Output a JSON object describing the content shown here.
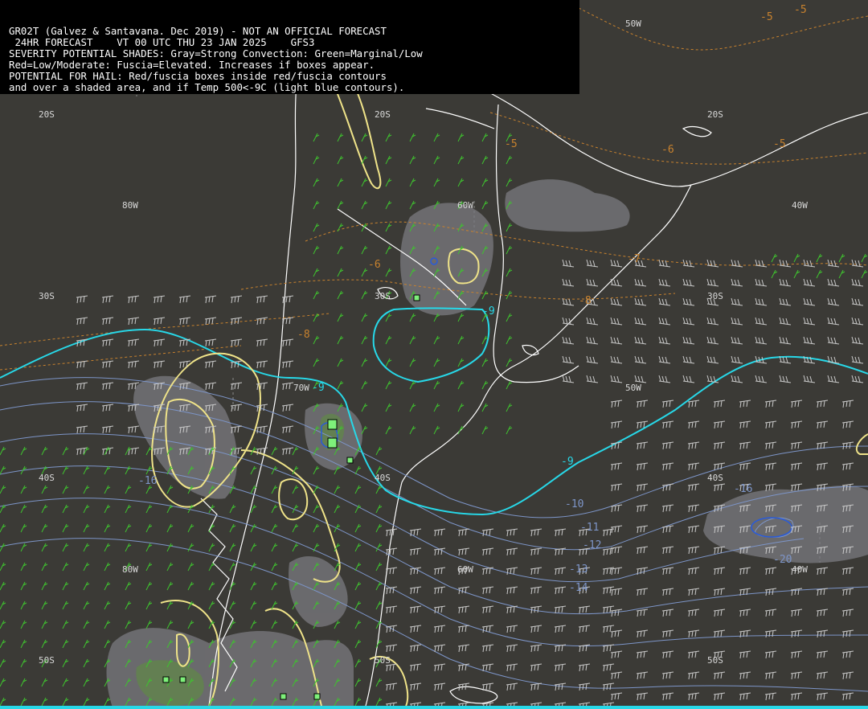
{
  "header": {
    "lines": [
      "GR02T (Galvez & Santavana. Dec 2019) - NOT AN OFFICIAL FORECAST",
      " 24HR FORECAST    VT 00 UTC THU 23 JAN 2025    GFS3",
      "SEVERITY POTENTIAL SHADES: Gray=Strong Convection: Green=Marginal/Low",
      "Red=Low/Moderate: Fuscia=Elevated. Increases if boxes appear.",
      "POTENTIAL FOR HAIL: Red/fuscia boxes inside red/fuscia contours",
      "and over a shaded area, and if Temp 500<-9C (light blue contours)."
    ]
  },
  "grid_labels": {
    "lat_20s": "20S",
    "lat_30s": "30S",
    "lat_40s": "40S",
    "lat_50s": "50S",
    "lon_80w": "80W",
    "lon_70w": "70W",
    "lon_60w": "60W",
    "lon_50w": "50W",
    "lon_40w": "40W"
  },
  "contour_labels": {
    "t_m5": "-5",
    "t_m6": "-6",
    "t_m7": "-7",
    "t_m8": "-8",
    "t_m9": "-9",
    "t_m10": "-10",
    "t_m11": "-11",
    "t_m12": "-12",
    "t_m13": "-13",
    "t_m14": "-14",
    "t_m16": "-16",
    "t_m20": "-20"
  },
  "colors": {
    "background": "#3b3a36",
    "coastline": "#ffffff",
    "minus9_contour": "#27d8e8",
    "cold_contours": "#7d95c8",
    "warm_dashed": "#c8822e",
    "yellow_contour": "#efe389",
    "wind_barbs_green": "#3fc22f",
    "wind_barbs_white": "#c9c9c9",
    "gray_shade": "#7b7b80",
    "green_box": "#7ef07a"
  }
}
